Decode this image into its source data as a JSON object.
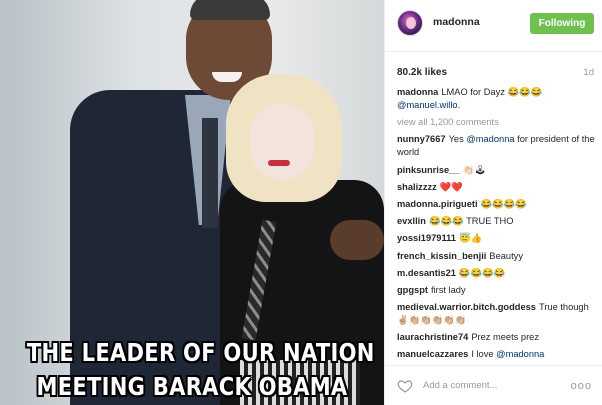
{
  "photo": {
    "caption_lines": [
      "THE LEADER OF OUR NATION",
      "MEETING BARACK OBAMA"
    ]
  },
  "header": {
    "username": "madonna",
    "follow_label": "Following",
    "follow_color": "#70c050"
  },
  "stats": {
    "likes": "80.2k likes",
    "age": "1d"
  },
  "caption": {
    "user": "madonna",
    "text": "LMAO for Dayz 😂😂😂",
    "mention": "@manuel.willo."
  },
  "view_all": "view all 1,200 comments",
  "comments": [
    {
      "user": "nunny7667",
      "text": "Yes ",
      "mention": "@madonna",
      "text2": " for president of the world"
    },
    {
      "user": "pinksunrise__",
      "text": "👏🏻🕹",
      "mention": "",
      "text2": ""
    },
    {
      "user": "shalizzzz",
      "text": "❤️❤️",
      "mention": "",
      "text2": ""
    },
    {
      "user": "madonna.pirigueti",
      "text": "😂😂😂😂",
      "mention": "",
      "text2": ""
    },
    {
      "user": "evxllin",
      "text": "😂😂😂 TRUE THO",
      "mention": "",
      "text2": ""
    },
    {
      "user": "yossi1979111",
      "text": "😇👍",
      "mention": "",
      "text2": ""
    },
    {
      "user": "french_kissin_benjii",
      "text": "Beautyy",
      "mention": "",
      "text2": ""
    },
    {
      "user": "m.desantis21",
      "text": "😂😂😂😂",
      "mention": "",
      "text2": ""
    },
    {
      "user": "gpgspt",
      "text": "first lady",
      "mention": "",
      "text2": ""
    },
    {
      "user": "medieval.warrior.bitch.goddess",
      "text": "True though ✌🏼👏🏼👏🏼👏🏼👏🏼👏🏼",
      "mention": "",
      "text2": ""
    },
    {
      "user": "laurachristine74",
      "text": "Prez meets prez",
      "mention": "",
      "text2": ""
    },
    {
      "user": "manuelcazzares",
      "text": "I love ",
      "mention": "@madonna",
      "text2": ""
    }
  ],
  "footer": {
    "heart_icon": "heart-outline-icon",
    "placeholder": "Add a comment...",
    "more": "ooo"
  }
}
